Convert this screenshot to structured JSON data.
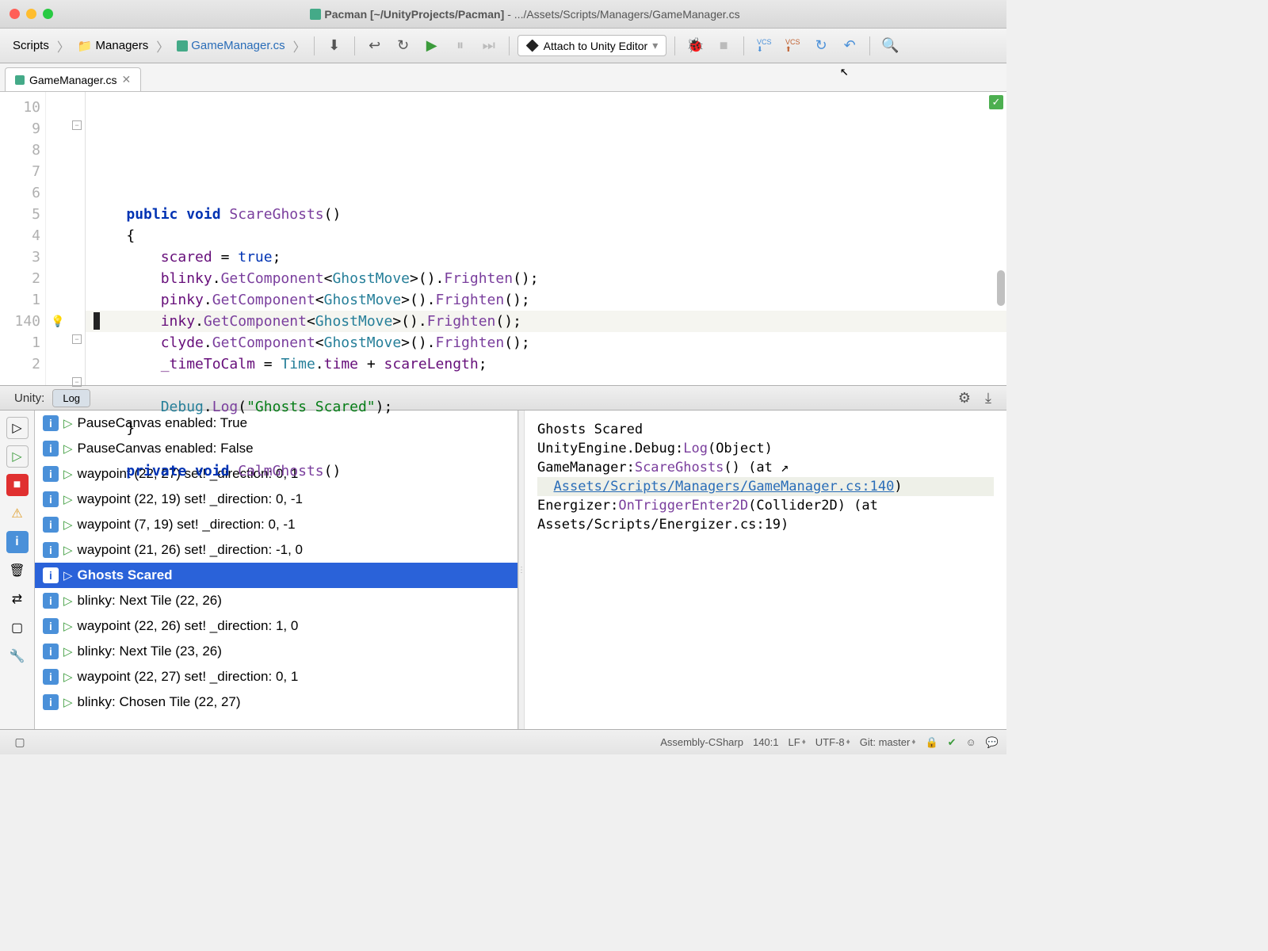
{
  "window": {
    "title_primary": "Pacman [~/UnityProjects/Pacman]",
    "title_secondary": " - .../Assets/Scripts/Managers/GameManager.cs"
  },
  "breadcrumb": {
    "items": [
      {
        "label": "Scripts",
        "icon": "none"
      },
      {
        "label": "Managers",
        "icon": "folder"
      },
      {
        "label": "GameManager.cs",
        "icon": "cs"
      }
    ]
  },
  "attach": {
    "label": "Attach to Unity Editor"
  },
  "tab": {
    "name": "GameManager.cs"
  },
  "line_numbers": [
    "10",
    "9",
    "8",
    "7",
    "6",
    "5",
    "4",
    "3",
    "2",
    "1",
    "140",
    "1",
    "2",
    ""
  ],
  "code_tokens": [
    [
      {
        "t": "    ",
        "c": ""
      }
    ],
    [
      {
        "t": "    ",
        "c": ""
      },
      {
        "t": "public void",
        "c": "kw"
      },
      {
        "t": " ",
        "c": ""
      },
      {
        "t": "ScareGhosts",
        "c": "fn"
      },
      {
        "t": "()",
        "c": ""
      }
    ],
    [
      {
        "t": "    {",
        "c": ""
      }
    ],
    [
      {
        "t": "        ",
        "c": ""
      },
      {
        "t": "scared",
        "c": "var"
      },
      {
        "t": " = ",
        "c": ""
      },
      {
        "t": "true",
        "c": "kw2"
      },
      {
        "t": ";",
        "c": ""
      }
    ],
    [
      {
        "t": "        ",
        "c": ""
      },
      {
        "t": "blinky",
        "c": "var"
      },
      {
        "t": ".",
        "c": ""
      },
      {
        "t": "GetComponent",
        "c": "fn"
      },
      {
        "t": "<",
        "c": ""
      },
      {
        "t": "GhostMove",
        "c": "type"
      },
      {
        "t": ">().",
        "c": ""
      },
      {
        "t": "Frighten",
        "c": "fn"
      },
      {
        "t": "();",
        "c": ""
      }
    ],
    [
      {
        "t": "        ",
        "c": ""
      },
      {
        "t": "pinky",
        "c": "var"
      },
      {
        "t": ".",
        "c": ""
      },
      {
        "t": "GetComponent",
        "c": "fn"
      },
      {
        "t": "<",
        "c": ""
      },
      {
        "t": "GhostMove",
        "c": "type"
      },
      {
        "t": ">().",
        "c": ""
      },
      {
        "t": "Frighten",
        "c": "fn"
      },
      {
        "t": "();",
        "c": ""
      }
    ],
    [
      {
        "t": "        ",
        "c": ""
      },
      {
        "t": "inky",
        "c": "var"
      },
      {
        "t": ".",
        "c": ""
      },
      {
        "t": "GetComponent",
        "c": "fn"
      },
      {
        "t": "<",
        "c": ""
      },
      {
        "t": "GhostMove",
        "c": "type"
      },
      {
        "t": ">().",
        "c": ""
      },
      {
        "t": "Frighten",
        "c": "fn"
      },
      {
        "t": "();",
        "c": ""
      }
    ],
    [
      {
        "t": "        ",
        "c": ""
      },
      {
        "t": "clyde",
        "c": "var"
      },
      {
        "t": ".",
        "c": ""
      },
      {
        "t": "GetComponent",
        "c": "fn"
      },
      {
        "t": "<",
        "c": ""
      },
      {
        "t": "GhostMove",
        "c": "type"
      },
      {
        "t": ">().",
        "c": ""
      },
      {
        "t": "Frighten",
        "c": "fn"
      },
      {
        "t": "();",
        "c": ""
      }
    ],
    [
      {
        "t": "        ",
        "c": ""
      },
      {
        "t": "_timeToCalm",
        "c": "var"
      },
      {
        "t": " = ",
        "c": ""
      },
      {
        "t": "Time",
        "c": "type"
      },
      {
        "t": ".",
        "c": ""
      },
      {
        "t": "time",
        "c": "var"
      },
      {
        "t": " + ",
        "c": ""
      },
      {
        "t": "scareLength",
        "c": "var"
      },
      {
        "t": ";",
        "c": ""
      }
    ],
    [
      {
        "t": " ",
        "c": ""
      }
    ],
    [
      {
        "t": "        ",
        "c": ""
      },
      {
        "t": "Debug",
        "c": "type"
      },
      {
        "t": ".",
        "c": ""
      },
      {
        "t": "Log",
        "c": "fn"
      },
      {
        "t": "(",
        "c": ""
      },
      {
        "t": "\"Ghosts Scared\"",
        "c": "str"
      },
      {
        "t": ");",
        "c": ""
      }
    ],
    [
      {
        "t": "    }",
        "c": ""
      }
    ],
    [
      {
        "t": " ",
        "c": ""
      }
    ],
    [
      {
        "t": "    ",
        "c": ""
      },
      {
        "t": "private void",
        "c": "kw"
      },
      {
        "t": " ",
        "c": ""
      },
      {
        "t": "CalmGhosts",
        "c": "fn"
      },
      {
        "t": "()",
        "c": ""
      }
    ]
  ],
  "panel": {
    "unity_label": "Unity:",
    "log_label": "Log"
  },
  "log_entries": [
    {
      "text": "PauseCanvas enabled: True"
    },
    {
      "text": "PauseCanvas enabled: False"
    },
    {
      "text": "waypoint (22, 27) set! _direction: 0, 1"
    },
    {
      "text": "waypoint (22, 19) set! _direction: 0, -1"
    },
    {
      "text": "waypoint (7, 19) set! _direction: 0, -1"
    },
    {
      "text": "waypoint (21, 26) set! _direction: -1, 0"
    },
    {
      "text": "Ghosts Scared",
      "selected": true
    },
    {
      "text": "blinky: Next Tile (22, 26)"
    },
    {
      "text": "waypoint (22, 26) set! _direction: 1, 0"
    },
    {
      "text": "blinky: Next Tile (23, 26)"
    },
    {
      "text": "waypoint (22, 27) set! _direction: 0, 1"
    },
    {
      "text": "blinky: Chosen Tile (22, 27)"
    }
  ],
  "detail": {
    "line1": "Ghosts Scared",
    "line2_a": "UnityEngine.Debug:",
    "line2_b": "Log",
    "line2_c": "(Object)",
    "line3_a": "GameManager:",
    "line3_b": "ScareGhosts",
    "line3_c": "() (at",
    "line4_link": "Assets/Scripts/Managers/GameManager.cs:140",
    "line4_end": ")",
    "line5_a": "Energizer:",
    "line5_b": "OnTriggerEnter2D",
    "line5_c": "(Collider2D) (at",
    "line6": "  Assets/Scripts/Energizer.cs:19",
    "line6_end": ")"
  },
  "status": {
    "assembly": "Assembly-CSharp",
    "pos": "140:1",
    "line_end": "LF",
    "encoding": "UTF-8",
    "git": "Git: master"
  }
}
